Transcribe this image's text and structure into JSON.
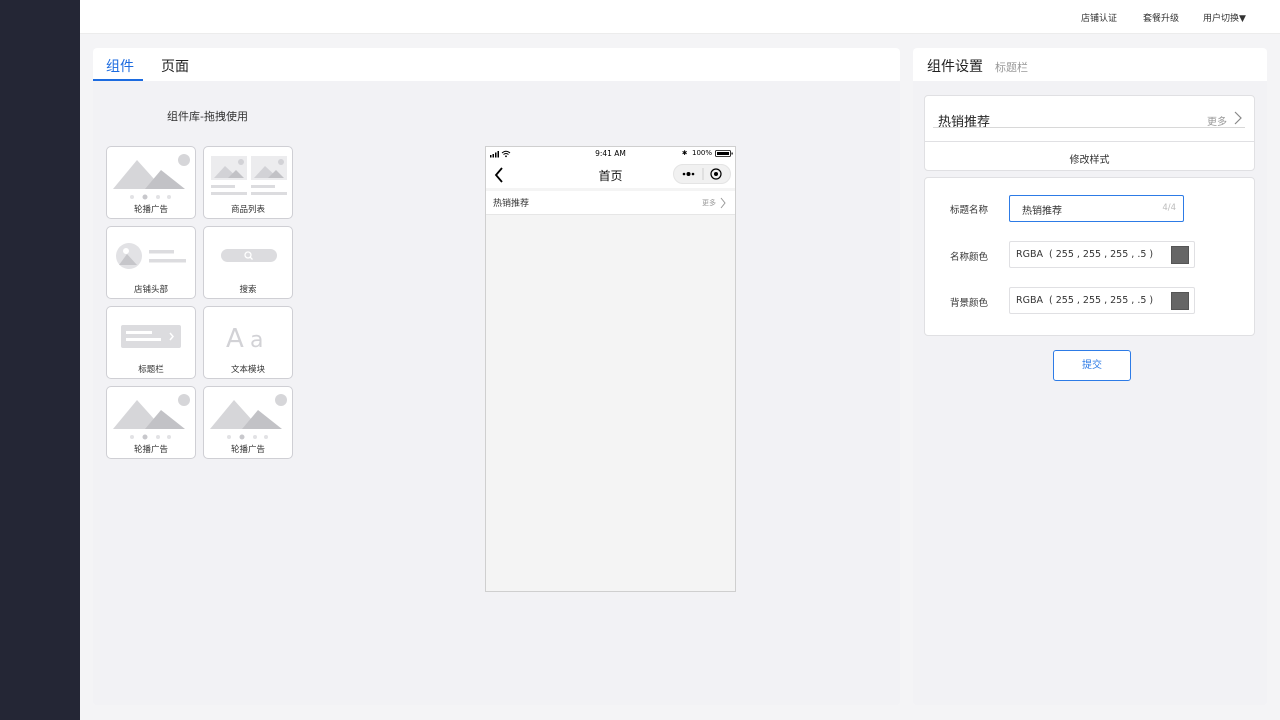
{
  "topbar": {
    "store_certification": "店铺认证",
    "plan_upgrade": "套餐升级",
    "user_switch": "用户切换▼"
  },
  "left_panel": {
    "tabs": [
      {
        "label": "组件",
        "active": true
      },
      {
        "label": "页面",
        "active": false
      }
    ],
    "library_title": "组件库-拖拽使用",
    "components": [
      {
        "label": "轮播广告",
        "icon": "carousel-icon"
      },
      {
        "label": "商品列表",
        "icon": "product-list-icon"
      },
      {
        "label": "店铺头部",
        "icon": "store-header-icon"
      },
      {
        "label": "搜索",
        "icon": "search-bar-icon"
      },
      {
        "label": "标题栏",
        "icon": "title-bar-icon"
      },
      {
        "label": "文本模块",
        "icon": "text-module-icon"
      },
      {
        "label": "轮播广告",
        "icon": "carousel-icon"
      },
      {
        "label": "轮播广告",
        "icon": "carousel-icon"
      }
    ]
  },
  "phone": {
    "status_time": "9:41 AM",
    "battery": "100%",
    "nav_title": "首页",
    "title_bar_text": "热销推荐",
    "title_bar_more": "更多"
  },
  "right_panel": {
    "tab_active": "组件设置",
    "tab_sub": "标题栏",
    "preview_title": "热销推荐",
    "preview_more": "更多",
    "modify_style": "修改样式",
    "form": {
      "name_label": "标题名称",
      "name_value": "热销推荐",
      "name_count": "4/4",
      "name_color_label": "名称颜色",
      "name_color_value": "RGBA  ( 255 , 255 , 255 , .5 )",
      "bg_color_label": "背景颜色",
      "bg_color_value": "RGBA  ( 255 , 255 , 255 , .5 )",
      "swatch_color": "#666666"
    },
    "submit_label": "提交"
  },
  "colors": {
    "sidebar": "#242635",
    "accent": "#1c6be0",
    "panel_bg": "#f2f2f5"
  }
}
